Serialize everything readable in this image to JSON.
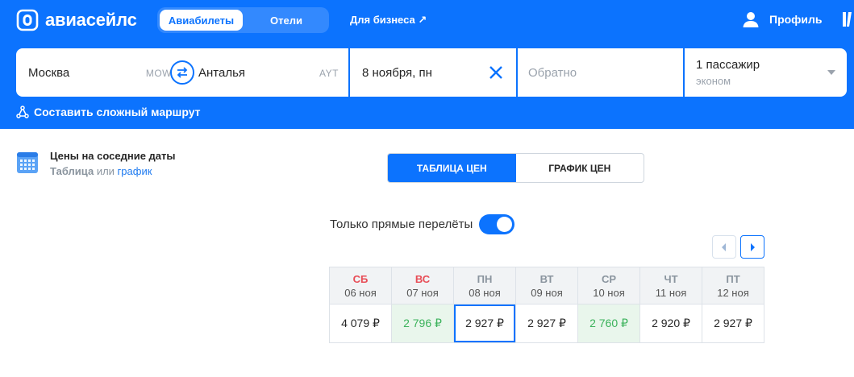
{
  "brand": {
    "name": "авиасейлс"
  },
  "nav": {
    "tabs": [
      {
        "label": "Авиабилеты",
        "active": true
      },
      {
        "label": "Отели",
        "active": false
      }
    ],
    "business_link": "Для бизнеса ↗",
    "profile_label": "Профиль"
  },
  "search": {
    "origin": {
      "city": "Москва",
      "code": "MOW"
    },
    "destination": {
      "city": "Анталья",
      "code": "AYT"
    },
    "depart_date": "8 ноября, пн",
    "return_placeholder": "Обратно",
    "passengers": "1 пассажир",
    "cabin_class": "эконом"
  },
  "complex_route_label": "Составить сложный маршрут",
  "nearby_dates": {
    "title": "Цены на соседние даты",
    "subtitle_table": "Таблица",
    "subtitle_or": "или",
    "subtitle_chart": "график"
  },
  "view_switch": {
    "table_label": "ТАБЛИЦА ЦЕН",
    "chart_label": "ГРАФИК ЦЕН",
    "active": "table"
  },
  "direct_only": {
    "label": "Только прямые перелёты",
    "enabled": true
  },
  "price_table": {
    "columns": [
      {
        "dow": "СБ",
        "date": "06 ноя",
        "price": "4 079 ₽",
        "weekend": true,
        "cheap": false,
        "selected": false
      },
      {
        "dow": "ВС",
        "date": "07 ноя",
        "price": "2 796 ₽",
        "weekend": true,
        "cheap": true,
        "selected": false
      },
      {
        "dow": "ПН",
        "date": "08 ноя",
        "price": "2 927 ₽",
        "weekend": false,
        "cheap": false,
        "selected": true
      },
      {
        "dow": "ВТ",
        "date": "09 ноя",
        "price": "2 927 ₽",
        "weekend": false,
        "cheap": false,
        "selected": false
      },
      {
        "dow": "СР",
        "date": "10 ноя",
        "price": "2 760 ₽",
        "weekend": false,
        "cheap": true,
        "selected": false
      },
      {
        "dow": "ЧТ",
        "date": "11 ноя",
        "price": "2 920 ₽",
        "weekend": false,
        "cheap": false,
        "selected": false
      },
      {
        "dow": "ПТ",
        "date": "12 ноя",
        "price": "2 927 ₽",
        "weekend": false,
        "cheap": false,
        "selected": false
      }
    ]
  },
  "colors": {
    "brand_blue": "#0c73fe",
    "cheap_green": "#3bb25b",
    "weekend_red": "#e84c56"
  }
}
